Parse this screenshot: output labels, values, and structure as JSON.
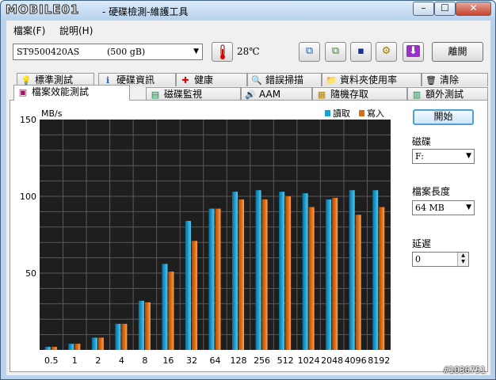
{
  "window": {
    "logo": "MOBILE01",
    "title": "- 硬碟檢測-維護工具",
    "min_label": "–",
    "max_label": "☐",
    "close_label": "✕"
  },
  "menu": [
    {
      "label": "檔案(F)"
    },
    {
      "label": "說明(H)"
    }
  ],
  "toolbar": {
    "disk_name": "ST9500420AS",
    "disk_size": "(500 gB)",
    "temperature": "28℃",
    "exit_label": "離開"
  },
  "tabs_row1": [
    {
      "label": "標準測試",
      "icon": "lightbulb-icon",
      "glyph": "💡"
    },
    {
      "label": "硬碟資訊",
      "icon": "info-icon",
      "glyph": "ℹ"
    },
    {
      "label": "健康",
      "icon": "health-cross-icon",
      "glyph": "✚"
    },
    {
      "label": "錯誤掃描",
      "icon": "magnifier-icon",
      "glyph": "🔍"
    },
    {
      "label": "資料夾使用率",
      "icon": "folder-icon",
      "glyph": "📁"
    },
    {
      "label": "清除",
      "icon": "trash-icon",
      "glyph": "🗑"
    }
  ],
  "tabs_row2": [
    {
      "label": "檔案效能測試",
      "icon": "file-benchmark-icon",
      "glyph": "▣",
      "active": true
    },
    {
      "label": "磁碟監視",
      "icon": "monitor-icon",
      "glyph": "▤"
    },
    {
      "label": "AAM",
      "icon": "speaker-icon",
      "glyph": "🔊"
    },
    {
      "label": "隨機存取",
      "icon": "random-access-icon",
      "glyph": "▦"
    },
    {
      "label": "額外測試",
      "icon": "extra-test-icon",
      "glyph": "▥"
    }
  ],
  "side": {
    "start_label": "開始",
    "disk_label": "磁碟",
    "disk_value": "F:",
    "filesize_label": "檔案長度",
    "filesize_value": "64 MB",
    "delay_label": "延遲",
    "delay_value": "0"
  },
  "colors": {
    "read": "#1a9fd0",
    "write": "#e06a10",
    "plot_bg": "#1e1e1e"
  },
  "watermark": "#1036751",
  "chart_data": {
    "type": "bar",
    "ylabel": "MB/s",
    "ylim": [
      0,
      150
    ],
    "yticks": [
      "150",
      "100",
      "50"
    ],
    "categories": [
      "0.5",
      "1",
      "2",
      "4",
      "8",
      "16",
      "32",
      "64",
      "128",
      "256",
      "512",
      "1024",
      "2048",
      "4096",
      "8192"
    ],
    "series": [
      {
        "name": "讀取",
        "values": [
          2,
          4,
          8,
          17,
          32,
          56,
          84,
          92,
          103,
          104,
          103,
          102,
          98,
          104,
          104
        ]
      },
      {
        "name": "寫入",
        "values": [
          2,
          4,
          8,
          17,
          31,
          51,
          71,
          92,
          98,
          98,
          100,
          93,
          99,
          88,
          93
        ]
      }
    ],
    "grid": true,
    "legend": "top-right"
  }
}
